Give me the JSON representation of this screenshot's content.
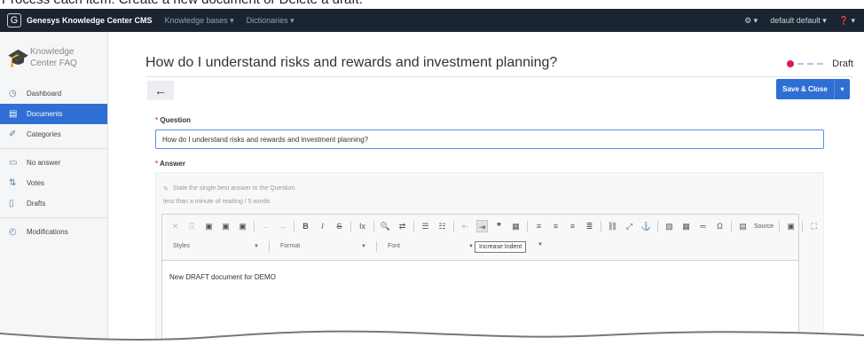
{
  "caption": "Process each item: Create a new document or Delete a draft.",
  "topbar": {
    "brand": "Genesys Knowledge Center CMS",
    "menus": [
      "Knowledge bases ▾",
      "Dictionaries ▾"
    ],
    "settings": "⚙ ▾",
    "user": "default default ▾",
    "help": "❓ ▾"
  },
  "sidebar": {
    "kb_name_line1": "Knowledge",
    "kb_name_line2": "Center FAQ",
    "items": [
      {
        "label": "Dashboard",
        "icon": "dashboard-icon",
        "active": false
      },
      {
        "label": "Documents",
        "icon": "document-icon",
        "active": true
      },
      {
        "label": "Categories",
        "icon": "tag-icon",
        "active": false
      },
      {
        "label": "No answer",
        "icon": "chat-icon",
        "active": false
      },
      {
        "label": "Votes",
        "icon": "votes-icon",
        "active": false
      },
      {
        "label": "Drafts",
        "icon": "draft-icon",
        "active": false
      },
      {
        "label": "Modifications",
        "icon": "history-icon",
        "active": false
      }
    ]
  },
  "main": {
    "title": "How do I understand risks and rewards and investment planning?",
    "status": "Draft",
    "save_close": "Save & Close",
    "question_label": "Question",
    "question_value": "How do I understand risks and rewards and investment planning?",
    "answer_label": "Answer",
    "answer_hint": "State the single best answer to the Question.",
    "reading_time": "less than a minute of reading / 5 words",
    "toolbar": {
      "source_label": "Source",
      "styles": "Styles",
      "format": "Format",
      "font": "Font",
      "size": "Si",
      "tooltip": "Increase Indent"
    },
    "content": "New DRAFT document for DEMO"
  },
  "colors": {
    "topbar": "#1b2431",
    "accent": "#2f6fd3",
    "status_dot": "#e21b4a"
  }
}
